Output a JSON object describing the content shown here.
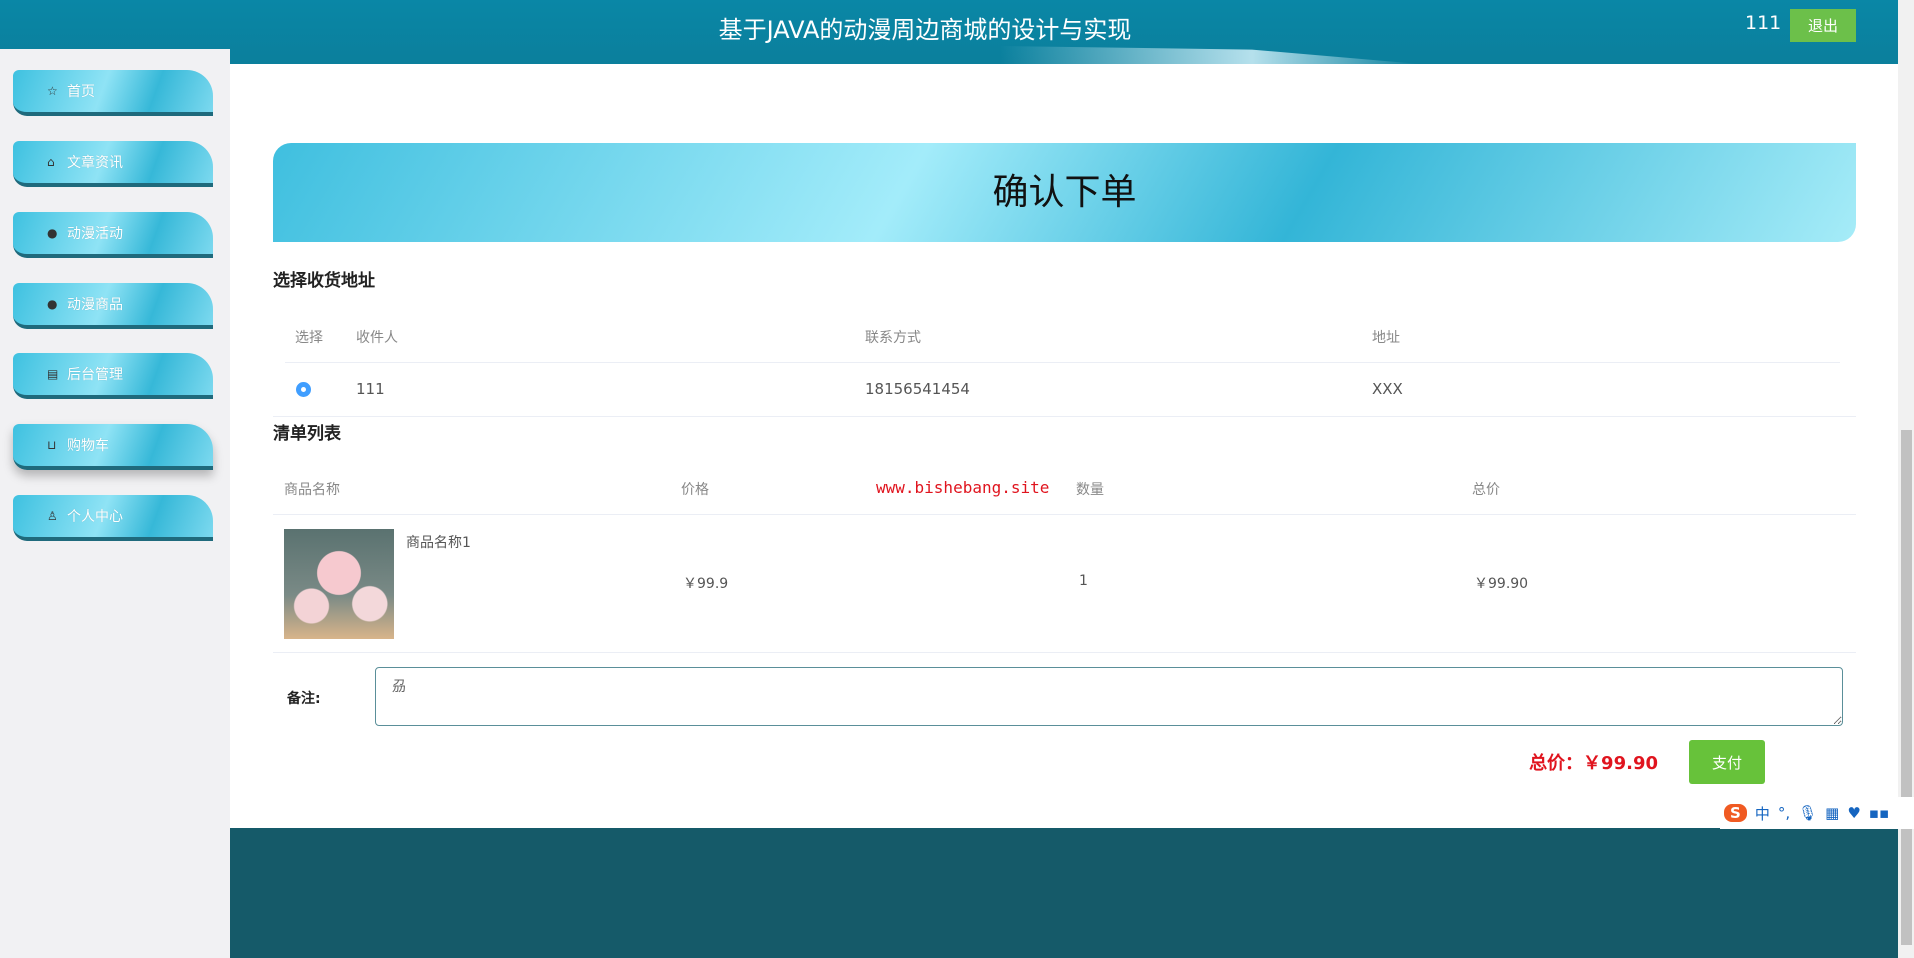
{
  "header": {
    "title": "基于JAVA的动漫周边商城的设计与实现",
    "username": "111",
    "logout_label": "退出"
  },
  "sidebar": {
    "items": [
      {
        "label": "首页",
        "icon": "star-icon",
        "glyph": "☆"
      },
      {
        "label": "文章资讯",
        "icon": "bag-icon",
        "glyph": "⌂"
      },
      {
        "label": "动漫活动",
        "icon": "info-icon",
        "glyph": "●"
      },
      {
        "label": "动漫商品",
        "icon": "question-icon",
        "glyph": "●"
      },
      {
        "label": "后台管理",
        "icon": "calendar-icon",
        "glyph": "▤"
      },
      {
        "label": "购物车",
        "icon": "cart-icon",
        "glyph": "⊔"
      },
      {
        "label": "个人中心",
        "icon": "user-icon",
        "glyph": "♙"
      }
    ],
    "active": "购物车"
  },
  "banner": {
    "title": "确认下单"
  },
  "address": {
    "section_title": "选择收货地址",
    "headers": [
      "选择",
      "收件人",
      "联系方式",
      "地址"
    ],
    "rows": [
      {
        "selected": true,
        "name": "111",
        "phone": "18156541454",
        "address": "XXX"
      }
    ]
  },
  "order": {
    "section_title": "清单列表",
    "headers": [
      "商品名称",
      "价格",
      "数量",
      "总价"
    ],
    "watermark": "www.bishebang.site",
    "items": [
      {
        "name": "商品名称1",
        "price": "￥99.9",
        "quantity": "1",
        "total": "￥99.90"
      }
    ]
  },
  "remark": {
    "label": "备注:",
    "value": "刕"
  },
  "summary": {
    "total": "总价：￥99.90",
    "pay_label": "支付"
  },
  "ime": {
    "lang": "中",
    "punct": "°,"
  },
  "colors": {
    "header": "#0a87a6",
    "footer": "#155a69",
    "accent_green": "#67c23a",
    "price_red": "#e0141e"
  }
}
